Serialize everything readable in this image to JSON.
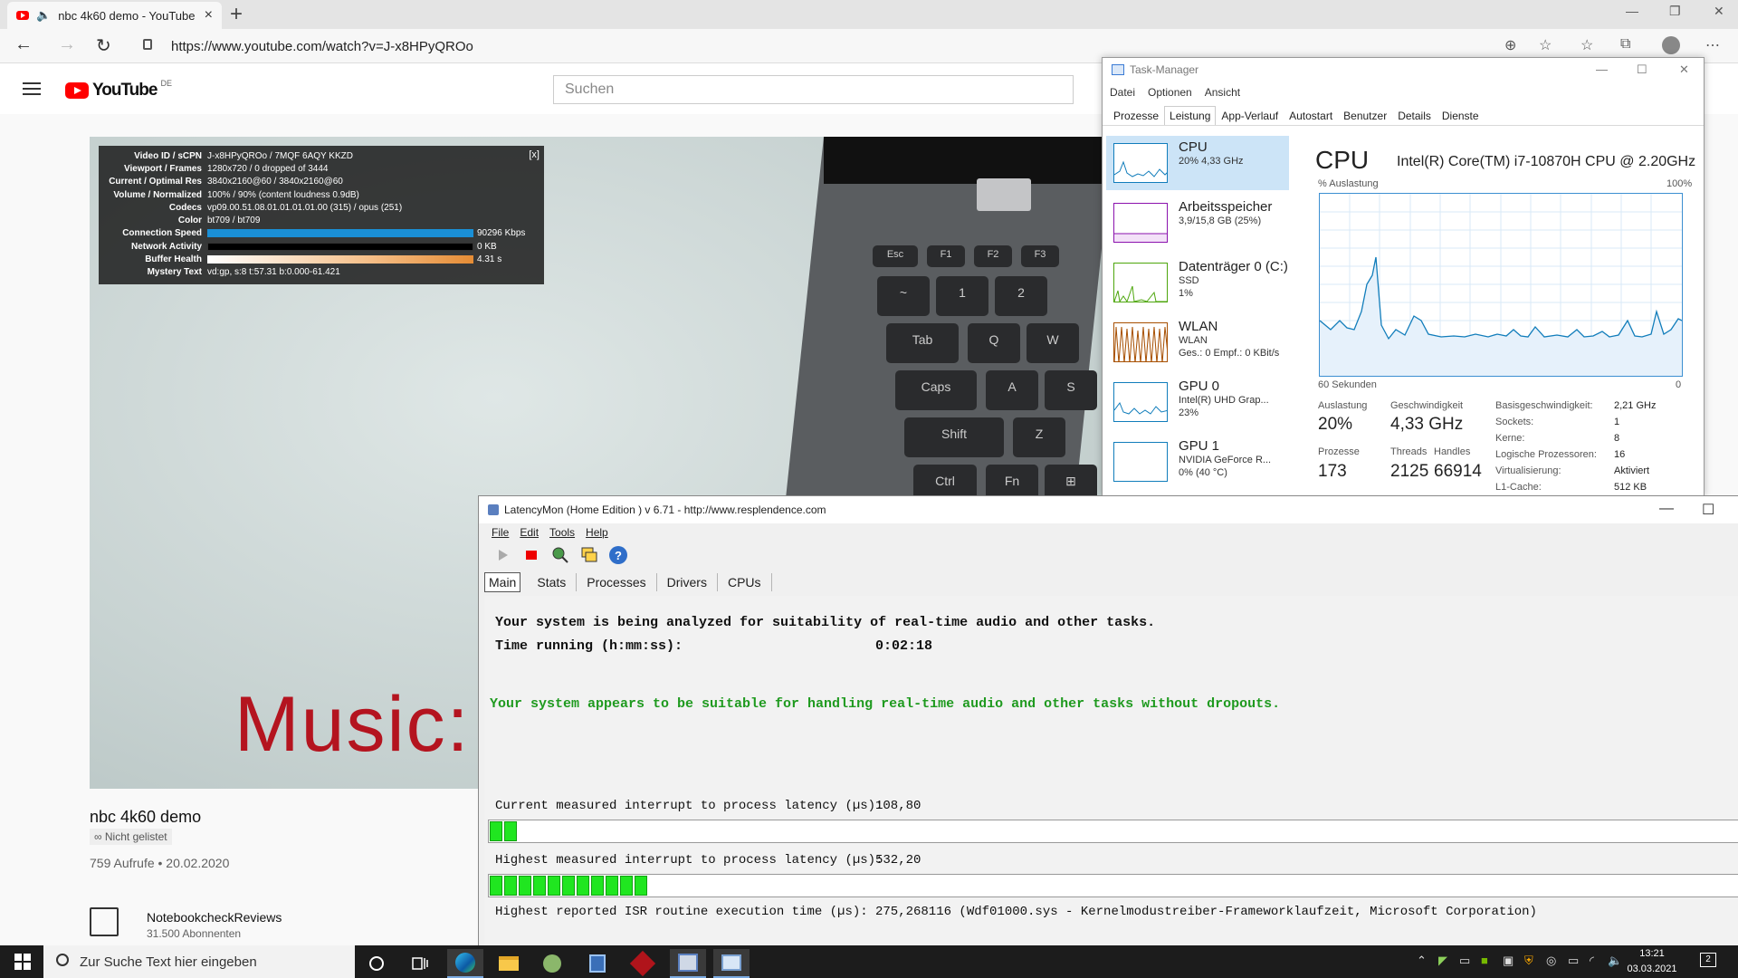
{
  "browser": {
    "tab_title": "nbc 4k60 demo - YouTube",
    "url": "https://www.youtube.com/watch?v=J-x8HPyQROo"
  },
  "youtube": {
    "logo_text": "YouTube",
    "logo_region": "DE",
    "search_placeholder": "Suchen",
    "video_overlay_text": "Music: E",
    "video_title": "nbc 4k60 demo",
    "unlisted": "Nicht gelistet",
    "views_date": "759 Aufrufe • 20.02.2020",
    "channel_name": "NotebookcheckReviews",
    "subscribers": "31.500 Abonnenten",
    "stats_close": "[x]",
    "stats": [
      {
        "k": "Video ID / sCPN",
        "v": "J-x8HPyQROo / 7MQF 6AQY KKZD"
      },
      {
        "k": "Viewport / Frames",
        "v": "1280x720 / 0 dropped of 3444"
      },
      {
        "k": "Current / Optimal Res",
        "v": "3840x2160@60 / 3840x2160@60"
      },
      {
        "k": "Volume / Normalized",
        "v": "100% / 90% (content loudness 0.9dB)"
      },
      {
        "k": "Codecs",
        "v": "vp09.00.51.08.01.01.01.01.00 (315) / opus (251)"
      },
      {
        "k": "Color",
        "v": "bt709 / bt709"
      },
      {
        "k": "Connection Speed",
        "v": "90296 Kbps"
      },
      {
        "k": "Network Activity",
        "v": "0 KB"
      },
      {
        "k": "Buffer Health",
        "v": "4.31 s"
      },
      {
        "k": "Mystery Text",
        "v": "vd:gp, s:8 t:57.31 b:0.000-61.421"
      }
    ]
  },
  "taskmgr": {
    "title": "Task-Manager",
    "menu": [
      "Datei",
      "Optionen",
      "Ansicht"
    ],
    "tabs": [
      "Prozesse",
      "Leistung",
      "App-Verlauf",
      "Autostart",
      "Benutzer",
      "Details",
      "Dienste"
    ],
    "side": [
      {
        "name": "CPU",
        "s1": "20% 4,33 GHz",
        "s2": "",
        "color": "#117dbb"
      },
      {
        "name": "Arbeitsspeicher",
        "s1": "3,9/15,8 GB (25%)",
        "s2": "",
        "color": "#8b12ae"
      },
      {
        "name": "Datenträger 0 (C:)",
        "s1": "SSD",
        "s2": "1%",
        "color": "#4da60c"
      },
      {
        "name": "WLAN",
        "s1": "WLAN",
        "s2": "Ges.: 0 Empf.: 0 KBit/s",
        "color": "#a74f01"
      },
      {
        "name": "GPU 0",
        "s1": "Intel(R) UHD Grap...",
        "s2": "23%",
        "color": "#117dbb"
      },
      {
        "name": "GPU 1",
        "s1": "NVIDIA GeForce R...",
        "s2": "0% (40 °C)",
        "color": "#117dbb"
      }
    ],
    "cpu_title": "CPU",
    "cpu_model": "Intel(R) Core(TM) i7-10870H CPU @ 2.20GHz",
    "graph_label": "% Auslastung",
    "graph_max": "100%",
    "graph_time": "60 Sekunden",
    "graph_min": "0",
    "stats": {
      "ausl_l": "Auslastung",
      "ausl_v": "20%",
      "ges_l": "Geschwindigkeit",
      "ges_v": "4,33 GHz",
      "proz_l": "Prozesse",
      "proz_v": "173",
      "thr_l": "Threads",
      "thr_v": "2125",
      "hnd_l": "Handles",
      "hnd_v": "66914"
    },
    "kv": [
      {
        "k": "Basisgeschwindigkeit:",
        "v": "2,21 GHz"
      },
      {
        "k": "Sockets:",
        "v": "1"
      },
      {
        "k": "Kerne:",
        "v": "8"
      },
      {
        "k": "Logische Prozessoren:",
        "v": "16"
      },
      {
        "k": "Virtualisierung:",
        "v": "Aktiviert"
      },
      {
        "k": "L1-Cache:",
        "v": "512 KB"
      }
    ]
  },
  "latencymon": {
    "title": "LatencyMon  (Home Edition )  v 6.71 - http://www.resplendence.com",
    "menu": [
      "File",
      "Edit",
      "Tools",
      "Help"
    ],
    "tabs": [
      "Main",
      "Stats",
      "Processes",
      "Drivers",
      "CPUs"
    ],
    "line1": "Your system is being analyzed for suitability of real-time audio and other tasks.",
    "time_label": "Time running (h:mm:ss):",
    "time_value": "0:02:18",
    "verdict": "Your system appears to be suitable for handling real-time audio and other tasks without dropouts.",
    "cur_label": "Current measured interrupt to process latency (µs):",
    "cur_value": "108,80",
    "high_label": "Highest measured interrupt to process latency (µs):",
    "high_value": "532,20",
    "isr_label": "Highest reported ISR routine execution time (µs):",
    "isr_value": "275,268116  (Wdf01000.sys - Kernelmodustreiber-Frameworklaufzeit, Microsoft Corporation)"
  },
  "taskbar": {
    "search_placeholder": "Zur Suche Text hier eingeben",
    "time": "13:21",
    "date": "03.03.2021",
    "notif_count": "2"
  }
}
